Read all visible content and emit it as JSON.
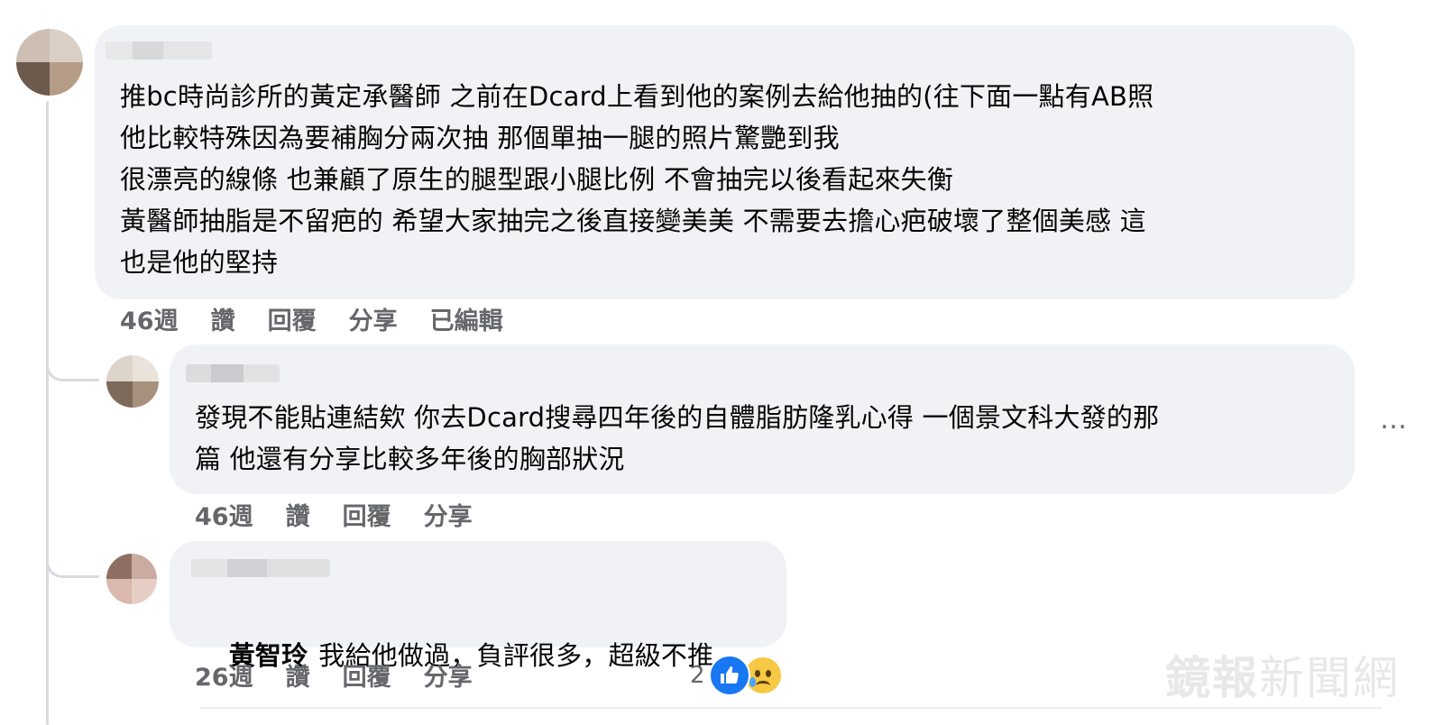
{
  "comments": [
    {
      "author": "",
      "lines": [
        "推bc時尚診所的黃定承醫師 之前在Dcard上看到他的案例去給他抽的(往下面一點有AB照",
        "他比較特殊因為要補胸分兩次抽 那個單抽一腿的照片驚艷到我",
        "很漂亮的線條 也兼顧了原生的腿型跟小腿比例 不會抽完以後看起來失衡",
        "黃醫師抽脂是不留疤的 希望大家抽完之後直接變美美 不需要去擔心疤破壞了整個美感 這",
        "也是他的堅持"
      ],
      "time": "46週",
      "like_label": "讚",
      "reply_label": "回覆",
      "share_label": "分享",
      "edited_label": "已編輯"
    },
    {
      "author": "",
      "lines": [
        "發現不能貼連結欸 你去Dcard搜尋四年後的自體脂肪隆乳心得 一個景文科大發的那",
        "篇 他還有分享比較多年後的胸部狀況"
      ],
      "time": "46週",
      "like_label": "讚",
      "reply_label": "回覆",
      "share_label": "分享",
      "more_label": "…"
    },
    {
      "author": "",
      "mention": "黃智玲",
      "text": "我給他做過，負評很多，超級不推",
      "time": "26週",
      "like_label": "讚",
      "reply_label": "回覆",
      "share_label": "分享",
      "reaction_count": "2",
      "reactions": [
        "like-icon",
        "sad-icon"
      ]
    }
  ],
  "watermark": {
    "bold_part": "鏡報",
    "light_part": "新聞網"
  },
  "colors": {
    "bubble": "#f0f2f5",
    "meta_text": "#65676b",
    "like_blue": "#1877f2",
    "thread_line": "#d7dadf"
  }
}
